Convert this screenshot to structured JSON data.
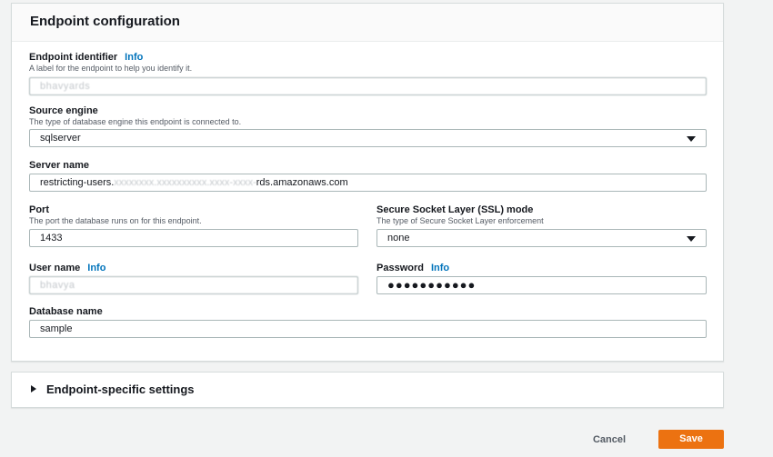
{
  "panel": {
    "title": "Endpoint configuration"
  },
  "info_link": "Info",
  "endpoint_identifier": {
    "label": "Endpoint identifier",
    "description": "A label for the endpoint to help you identify it.",
    "value": "bhavyards"
  },
  "source_engine": {
    "label": "Source engine",
    "description": "The type of database engine this endpoint is connected to.",
    "value": "sqlserver",
    "icon": "chevron-down-icon"
  },
  "server_name": {
    "label": "Server name",
    "value_visible_start": "restricting-users.",
    "value_redacted": "xxxxxxxx.xxxxxxxxxx.xxxx-xxxx-",
    "value_visible_end": "rds.amazonaws.com"
  },
  "port": {
    "label": "Port",
    "description": "The port the database runs on for this endpoint.",
    "value": "1433"
  },
  "ssl_mode": {
    "label": "Secure Socket Layer (SSL) mode",
    "description": "The type of Secure Socket Layer enforcement",
    "value": "none",
    "icon": "chevron-down-icon"
  },
  "user_name": {
    "label": "User name",
    "value": "bhavya"
  },
  "password": {
    "label": "Password",
    "value": "●●●●●●●●●●●"
  },
  "database_name": {
    "label": "Database name",
    "value": "sample"
  },
  "endpoint_specific_settings": {
    "title": "Endpoint-specific settings",
    "icon": "caret-right-icon"
  },
  "footer": {
    "cancel_label": "Cancel",
    "save_label": "Save"
  },
  "colors": {
    "primary_button": "#ec7211",
    "link": "#0073bb",
    "border": "#aab7b8",
    "background": "#f2f3f3"
  }
}
